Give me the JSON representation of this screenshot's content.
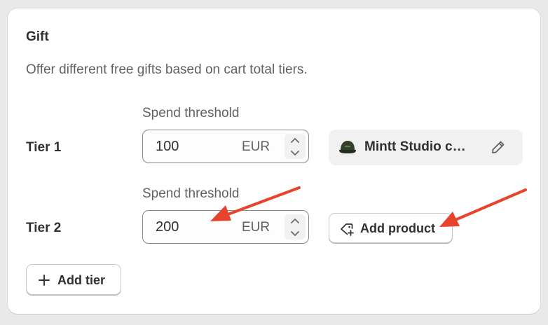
{
  "section": {
    "title": "Gift",
    "description": "Offer different free gifts based on cart total tiers."
  },
  "tiers": [
    {
      "label": "Tier 1",
      "threshold_label": "Spend threshold",
      "amount": "100",
      "currency": "EUR",
      "product": {
        "name": "Mintt Studio c…",
        "thumbnail_icon": "cap-thumbnail"
      }
    },
    {
      "label": "Tier 2",
      "threshold_label": "Spend threshold",
      "amount": "200",
      "currency": "EUR",
      "add_product_label": "Add product"
    }
  ],
  "add_tier_label": "Add tier",
  "icons": {
    "spinner_up": "chevron-up-icon",
    "spinner_down": "chevron-down-icon",
    "edit": "pencil-icon",
    "add_product": "tag-plus-icon",
    "add_tier": "plus-icon"
  },
  "colors": {
    "annotation_arrow": "#e8432c",
    "card_background": "#ffffff",
    "page_background": "#e9e9e9"
  }
}
